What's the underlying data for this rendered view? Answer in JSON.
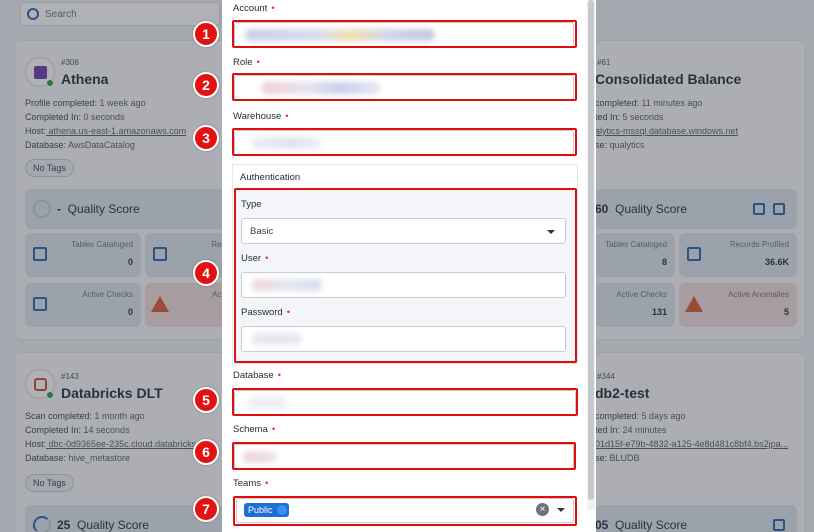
{
  "background": {
    "search_placeholder": "Search",
    "cards": [
      {
        "id": "#308",
        "name": "Athena",
        "meta": [
          {
            "label": "Profile completed:",
            "value": " 1 week ago"
          },
          {
            "label": "Completed In:",
            "value": " 0 seconds"
          },
          {
            "label": "Host:",
            "value": " athena.us-east-1.amazonaws.com"
          },
          {
            "label": "Database:",
            "value": " AwsDataCatalog"
          }
        ],
        "tag": "No Tags",
        "quality_score_value": "-",
        "quality_score_label": "Quality Score",
        "tiles": [
          {
            "label": "Tables Cataloged",
            "value": "0"
          },
          {
            "label": "Records",
            "value": ""
          },
          {
            "label": "Active Checks",
            "value": "0"
          },
          {
            "label": "Active A",
            "value": ""
          }
        ]
      },
      {
        "id": "#61",
        "name": "Consolidated Balance",
        "meta": [
          {
            "label": "completed:",
            "value": " 11 minutes ago"
          },
          {
            "label": "ted In:",
            "value": " 5 seconds"
          },
          {
            "label": "",
            "value": "alytics-mssql.database.windows.net"
          },
          {
            "label": "se:",
            "value": " qualytics"
          }
        ],
        "quality_score_value": "60",
        "quality_score_label": "Quality Score",
        "tiles": [
          {
            "label": "Tables Cataloged",
            "value": "8"
          },
          {
            "label": "Records Profiled",
            "value": "36.6K"
          },
          {
            "label": "Active Checks",
            "value": "131"
          },
          {
            "label": "Active Anomalies",
            "value": "5"
          }
        ]
      },
      {
        "id": "#143",
        "name": "Databricks DLT",
        "meta": [
          {
            "label": "Scan completed:",
            "value": " 1 month ago"
          },
          {
            "label": "Completed In:",
            "value": " 14 seconds"
          },
          {
            "label": "Host:",
            "value": " dbc-0d9365ee-235c.cloud.databricks"
          },
          {
            "label": "Database:",
            "value": " hive_metastore"
          }
        ],
        "tag": "No Tags",
        "quality_score_value": "25",
        "quality_score_label": "Quality Score"
      },
      {
        "id": "#344",
        "name": "db2-test",
        "meta": [
          {
            "label": "completed:",
            "value": " 5 days ago"
          },
          {
            "label": "ted In:",
            "value": " 24 minutes"
          },
          {
            "label": "",
            "value": "01d15f-e79b-4832-a125-4e8d481c8bf4.bs2jpa..."
          },
          {
            "label": "se:",
            "value": " BLUDB"
          }
        ],
        "quality_score_value": "05",
        "quality_score_label": "Quality Score"
      }
    ]
  },
  "modal": {
    "account_label": "Account",
    "role_label": "Role",
    "warehouse_label": "Warehouse",
    "authentication_title": "Authentication",
    "type_label": "Type",
    "type_value": "Basic",
    "user_label": "User",
    "password_label": "Password",
    "database_label": "Database",
    "schema_label": "Schema",
    "teams_label": "Teams",
    "teams_chip": "Public",
    "required_mark": "•"
  },
  "callouts": [
    "1",
    "2",
    "3",
    "4",
    "5",
    "6",
    "7"
  ],
  "colors": {
    "highlight": "#e00d0d",
    "badge": "#e21212",
    "chip": "#1e6fd0",
    "required": "#dc2670"
  }
}
